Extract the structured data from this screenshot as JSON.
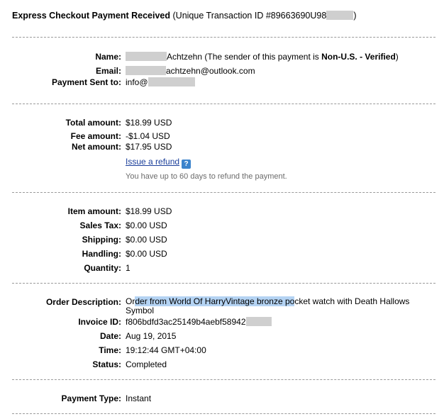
{
  "header": {
    "title_bold": "Express Checkout Payment Received",
    "title_prefix": " (Unique Transaction ID #89663690U98",
    "title_suffix": ")"
  },
  "sender": {
    "name_label": "Name:",
    "name_value": "Achtzehn (The sender of this payment is ",
    "name_status": "Non-U.S. - Verified",
    "name_close": ")",
    "email_label": "Email:",
    "email_value": "achtzehn@outlook.com",
    "sent_to_label": "Payment Sent to:",
    "sent_to_value": "info@"
  },
  "amounts": {
    "total_label": "Total amount:",
    "total_value": "$18.99 USD",
    "fee_label": "Fee amount:",
    "fee_value": "-$1.04 USD",
    "net_label": "Net amount:",
    "net_value": "$17.95 USD",
    "refund_link": "Issue a refund",
    "refund_help": "?",
    "refund_note": "You have up to 60 days to refund the payment."
  },
  "items": {
    "item_label": "Item amount:",
    "item_value": "$18.99 USD",
    "tax_label": "Sales Tax:",
    "tax_value": "$0.00 USD",
    "shipping_label": "Shipping:",
    "shipping_value": "$0.00 USD",
    "handling_label": "Handling:",
    "handling_value": "$0.00 USD",
    "quantity_label": "Quantity:",
    "quantity_value": "1"
  },
  "order": {
    "desc_label": "Order Description:",
    "desc_pre": "Or",
    "desc_highlight": "der from World Of HarryVintage bronze po",
    "desc_post": "cket watch with Death Hallows Symbol",
    "invoice_label": "Invoice ID:",
    "invoice_value": "f806bdfd3ac25149b4aebf58942",
    "date_label": "Date:",
    "date_value": "Aug 19, 2015",
    "time_label": "Time:",
    "time_value": "19:12:44 GMT+04:00",
    "status_label": "Status:",
    "status_value": "Completed"
  },
  "payment": {
    "type_label": "Payment Type:",
    "type_value": "Instant"
  }
}
